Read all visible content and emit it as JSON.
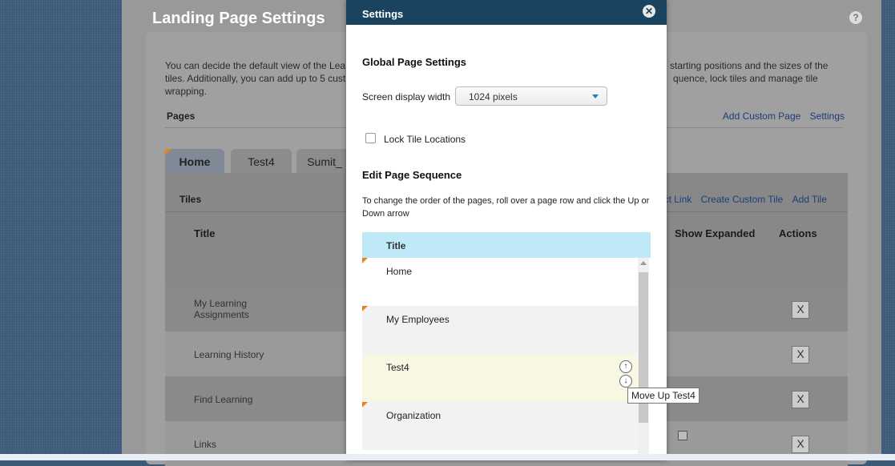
{
  "background": {
    "panel_title": "Landing Page Settings",
    "help_icon": "?"
  },
  "description": "You can decide the default view of the Lea... the starting positions and the sizes of the tiles. Additionally, you can add up to 5 cust... quence, lock tiles and manage tile wrapping.",
  "desc_left_1": "You can decide the default view of the Lea",
  "desc_right_1": "e starting positions and the sizes of the",
  "desc_left_2": "tiles. Additionally, you can add up to 5 cust",
  "desc_right_2": "quence, lock tiles and manage tile",
  "desc_left_3": "wrapping.",
  "pages": {
    "label": "Pages",
    "links": [
      "Add Custom Page",
      "Settings"
    ],
    "tabs": [
      "Home",
      "Test4",
      "Sumit_"
    ]
  },
  "tiles": {
    "label": "Tiles",
    "links": [
      "ct Link",
      "Create Custom Tile",
      "Add Tile"
    ],
    "headers": {
      "title": "Title",
      "show_expanded": "Show Expanded",
      "actions": "Actions"
    },
    "rows": [
      {
        "title": "My Learning Assignments",
        "delete": "X"
      },
      {
        "title": "Learning History",
        "delete": "X"
      },
      {
        "title": "Find Learning",
        "delete": "X"
      },
      {
        "title": "Links",
        "delete": "X"
      }
    ]
  },
  "modal": {
    "title": "Settings",
    "close_icon": "✕",
    "global_heading": "Global Page Settings",
    "screen_width_label": "Screen display width",
    "screen_width_value": "1024 pixels",
    "lock_label": "Lock Tile Locations",
    "sequence_heading": "Edit Page Sequence",
    "sequence_help": "To change the order of the pages, roll over a page row and click the Up or Down arrow",
    "sequence_col": "Title",
    "sequence_rows": [
      "Home",
      "My Employees",
      "Test4",
      "Organization"
    ],
    "tooltip": "Move Up Test4"
  },
  "colors": {
    "header": "#19435e",
    "accent": "#e38522",
    "seq_header": "#bfe9f7",
    "hover_row": "#f7f7e4"
  }
}
